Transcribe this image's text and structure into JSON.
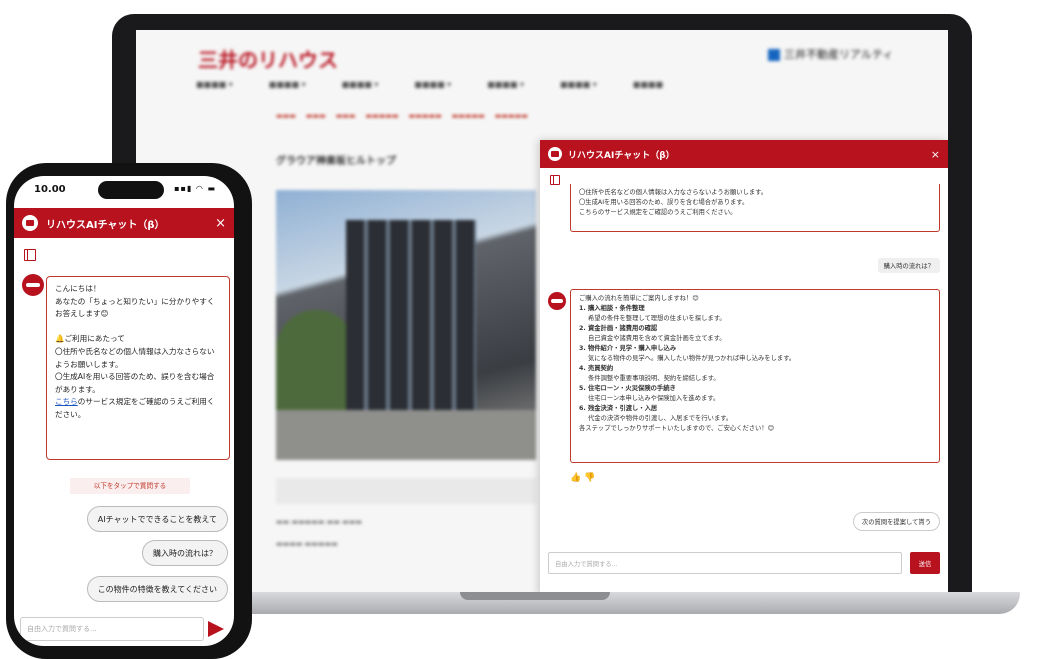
{
  "laptop": {
    "bg_page": {
      "logo": "三井のリハウス",
      "logo2": "三井不動産リアルティ",
      "title": "グラウア神楽坂ヒルトップ"
    },
    "chat": {
      "title": "リハウスAIチャット（β）",
      "close": "×",
      "intro_tail": [
        "〇住所や氏名などの個人情報は入力なさらないようお願いします。",
        "〇生成AIを用いる回答のため、誤りを含む場合があります。",
        "こちらのサービス規定をご確認のうえご利用ください。"
      ],
      "user_msg": "購入時の流れは？",
      "answer": {
        "lead": "ご購入の流れを簡単にご案内しますね！😊",
        "steps": [
          {
            "head": "1. 購入相談・条件整理",
            "body": "希望の条件を整理して理想の住まいを探します。"
          },
          {
            "head": "2. 資金計画・諸費用の確認",
            "body": "自己資金や諸費用を含めて資金計画を立てます。"
          },
          {
            "head": "3. 物件紹介・見学・購入申し込み",
            "body": "気になる物件の見学へ。購入したい物件が見つかれば申し込みをします。"
          },
          {
            "head": "4. 売買契約",
            "body": "条件調整や重要事項説明、契約を締結します。"
          },
          {
            "head": "5. 住宅ローン・火災保険の手続き",
            "body": "住宅ローン本申し込みや保険加入を進めます。"
          },
          {
            "head": "6. 残金決済・引渡し・入居",
            "body": "代金の決済や物件の引渡し、入居までを行います。"
          }
        ],
        "outro": "各ステップでしっかりサポートいたしますので、ご安心ください！😊"
      },
      "feedback": "👍 👎",
      "suggestion": "次の質問を提案して貰う",
      "input_placeholder": "自由入力で質問する...",
      "send_label": "送信"
    }
  },
  "phone": {
    "status_time": "10.00",
    "status_icons": "▪▪▮ ◠ ▬",
    "chat": {
      "title": "リハウスAIチャット（β）",
      "close": "×",
      "greeting": [
        "こんにちは！",
        "あなたの「ちょっと知りたい」に分かりやすくお答えします😊",
        "",
        "🔔ご利用にあたって",
        "〇住所や氏名などの個人情報は入力なさらないようお願いします。",
        "〇生成AIを用いる回答のため、誤りを含む場合があります。"
      ],
      "link_text": "こちら",
      "link_tail": "のサービス規定をご確認のうえご利用ください。",
      "tap_hint": "以下をタップで質問する",
      "quick_replies": [
        "AIチャットでできることを教えて",
        "購入時の流れは？",
        "この物件の特徴を教えてください"
      ],
      "input_placeholder": "自由入力で質問する..."
    }
  },
  "colors": {
    "brand": "#b8121f",
    "link": "#1a55c4"
  }
}
